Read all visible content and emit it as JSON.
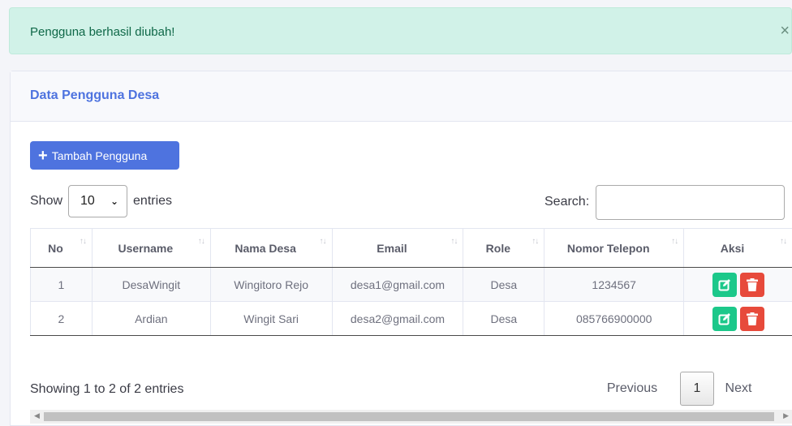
{
  "alert": {
    "message": "Pengguna berhasil diubah!",
    "close": "×"
  },
  "card": {
    "title": "Data Pengguna Desa"
  },
  "toolbar": {
    "add_label": "Tambah Pengguna",
    "add_icon": "plus-icon"
  },
  "length": {
    "show": "Show",
    "value": "10",
    "entries": "entries"
  },
  "search": {
    "label": "Search:",
    "value": "",
    "placeholder": ""
  },
  "table": {
    "headers": [
      "No",
      "Username",
      "Nama Desa",
      "Email",
      "Role",
      "Nomor Telepon",
      "Aksi"
    ],
    "rows": [
      {
        "no": "1",
        "username": "DesaWingit",
        "nama_desa": "Wingitoro Rejo",
        "email": "desa1@gmail.com",
        "role": "Desa",
        "telepon": "1234567"
      },
      {
        "no": "2",
        "username": "Ardian",
        "nama_desa": "Wingit Sari",
        "email": "desa2@gmail.com",
        "role": "Desa",
        "telepon": "085766900000"
      }
    ],
    "actions": {
      "edit_icon": "edit-icon",
      "delete_icon": "trash-icon"
    }
  },
  "footer": {
    "info": "Showing 1 to 2 of 2 entries"
  },
  "pagination": {
    "previous": "Previous",
    "current": "1",
    "next": "Next"
  },
  "colors": {
    "primary": "#4e73df",
    "success": "#1cc88a",
    "danger": "#e74a3b",
    "alert_bg": "#d1f2e8"
  }
}
